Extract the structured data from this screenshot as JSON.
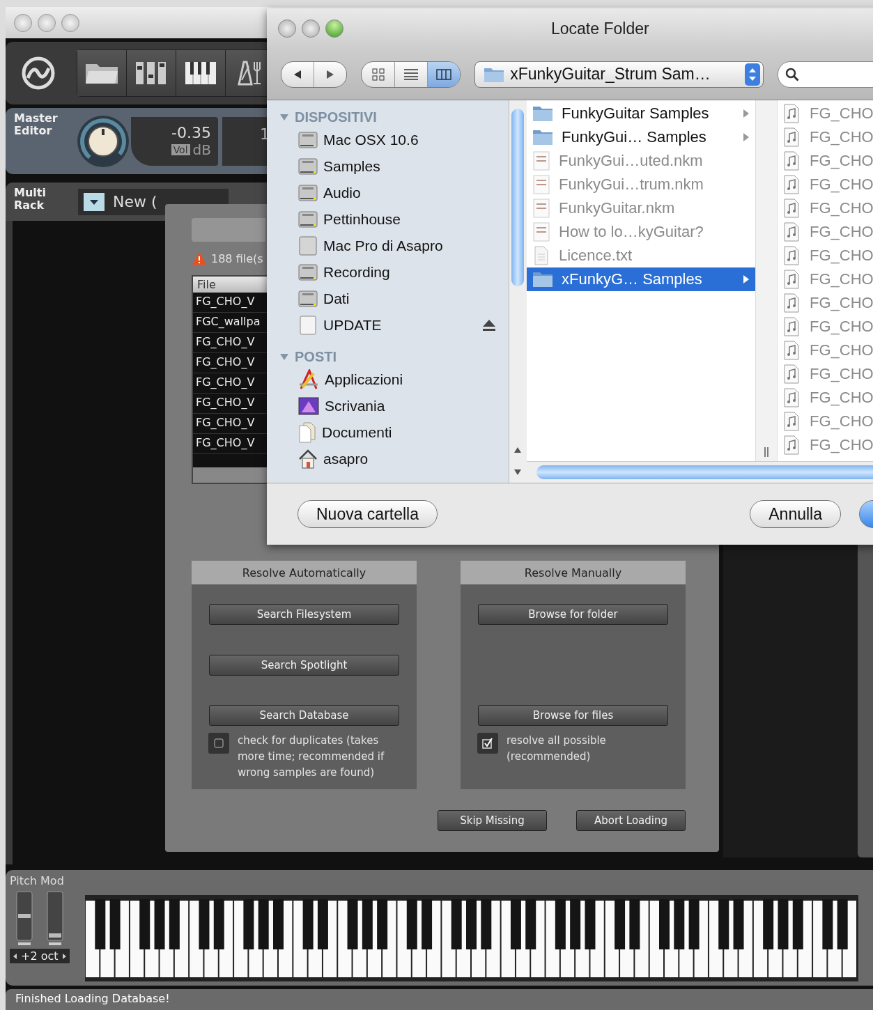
{
  "master": {
    "label": "Master Editor",
    "value": "-0.35",
    "tag": "Vol",
    "unit": "dB",
    "display_2": "1"
  },
  "rack": {
    "label": "Multi Rack",
    "preset": "New ("
  },
  "dialog": {
    "missing": "188 file(s",
    "list_header": "File",
    "rows": [
      "FG_CHO_V",
      "FGC_wallpa",
      "FG_CHO_V",
      "FG_CHO_V",
      "FG_CHO_V",
      "FG_CHO_V",
      "FG_CHO_V",
      "FG_CHO_V"
    ],
    "sections": [
      {
        "title": "Resolve Automatically",
        "buttons": [
          "Search Filesystem",
          "Search Spotlight",
          "Search Database"
        ],
        "option": {
          "text": "check for duplicates (takes more time; recommended if wrong samples are found)",
          "checked": false
        }
      },
      {
        "title": "Resolve Manually",
        "buttons": [
          "Browse for folder",
          "Browse for files"
        ],
        "option": {
          "text": "resolve all possible (recommended)",
          "checked": true
        }
      }
    ],
    "actions": [
      "Skip Missing",
      "Abort Loading"
    ]
  },
  "sheet": {
    "title": "Locate Folder",
    "path": "xFunkyGuitar_Strum Sam…",
    "view_modes": [
      {
        "kind": "icons",
        "selected": false
      },
      {
        "kind": "list",
        "selected": false
      },
      {
        "kind": "columns",
        "selected": true
      }
    ],
    "sidebar": [
      {
        "heading": "DISPOSITIVI",
        "expanded": true,
        "items": [
          {
            "label": "Mac OSX 10.6",
            "kind": "disk",
            "eject": false
          },
          {
            "label": "Samples",
            "kind": "disk",
            "eject": false
          },
          {
            "label": "Audio",
            "kind": "disk",
            "eject": false
          },
          {
            "label": "Pettinhouse",
            "kind": "disk",
            "eject": false
          },
          {
            "label": "Mac Pro di Asapro",
            "kind": "computer",
            "eject": false
          },
          {
            "label": "Recording",
            "kind": "disk",
            "eject": false
          },
          {
            "label": "Dati",
            "kind": "disk",
            "eject": false
          },
          {
            "label": "UPDATE",
            "kind": "removable",
            "eject": true
          }
        ]
      },
      {
        "heading": "POSTI",
        "expanded": true,
        "items": [
          {
            "label": "Applicazioni",
            "kind": "apps",
            "eject": false
          },
          {
            "label": "Scrivania",
            "kind": "desktop",
            "eject": false
          },
          {
            "label": "Documenti",
            "kind": "documents",
            "eject": false
          },
          {
            "label": "asapro",
            "kind": "home",
            "eject": false
          }
        ]
      }
    ],
    "column_1": [
      {
        "name": "FunkyGuitar Samples",
        "kind": "folder",
        "disabled": false,
        "selected": false
      },
      {
        "name": "FunkyGui… Samples",
        "kind": "folder",
        "disabled": false,
        "selected": false
      },
      {
        "name": "FunkyGui…uted.nkm",
        "kind": "nkm",
        "disabled": true,
        "selected": false
      },
      {
        "name": "FunkyGui…trum.nkm",
        "kind": "nkm",
        "disabled": true,
        "selected": false
      },
      {
        "name": "FunkyGuitar.nkm",
        "kind": "nkm",
        "disabled": true,
        "selected": false
      },
      {
        "name": "How to lo…kyGuitar?",
        "kind": "doc",
        "disabled": true,
        "selected": false
      },
      {
        "name": "Licence.txt",
        "kind": "txt",
        "disabled": true,
        "selected": false
      },
      {
        "name": "xFunkyG… Samples",
        "kind": "folder",
        "disabled": false,
        "selected": true
      }
    ],
    "column_2": [
      {
        "name": "FG_CHO",
        "disabled": true
      },
      {
        "name": "FG_CHO",
        "disabled": true
      },
      {
        "name": "FG_CHO",
        "disabled": true
      },
      {
        "name": "FG_CHO",
        "disabled": true
      },
      {
        "name": "FG_CHO",
        "disabled": true
      },
      {
        "name": "FG_CHO",
        "disabled": true
      },
      {
        "name": "FG_CHO",
        "disabled": true
      },
      {
        "name": "FG_CHO",
        "disabled": true
      },
      {
        "name": "FG_CHO",
        "disabled": true
      },
      {
        "name": "FG_CHO",
        "disabled": true
      },
      {
        "name": "FG_CHO",
        "disabled": true
      },
      {
        "name": "FG_CHO",
        "disabled": true
      },
      {
        "name": "FG_CHO",
        "disabled": true
      },
      {
        "name": "FG_CHO",
        "disabled": true
      },
      {
        "name": "FG_CHO",
        "disabled": true
      }
    ],
    "buttons": [
      "Nuova cartella",
      "Annulla"
    ]
  },
  "keyboard": {
    "label": "Pitch Mod",
    "octave": "+2 oct"
  },
  "status": "Finished Loading Database!"
}
